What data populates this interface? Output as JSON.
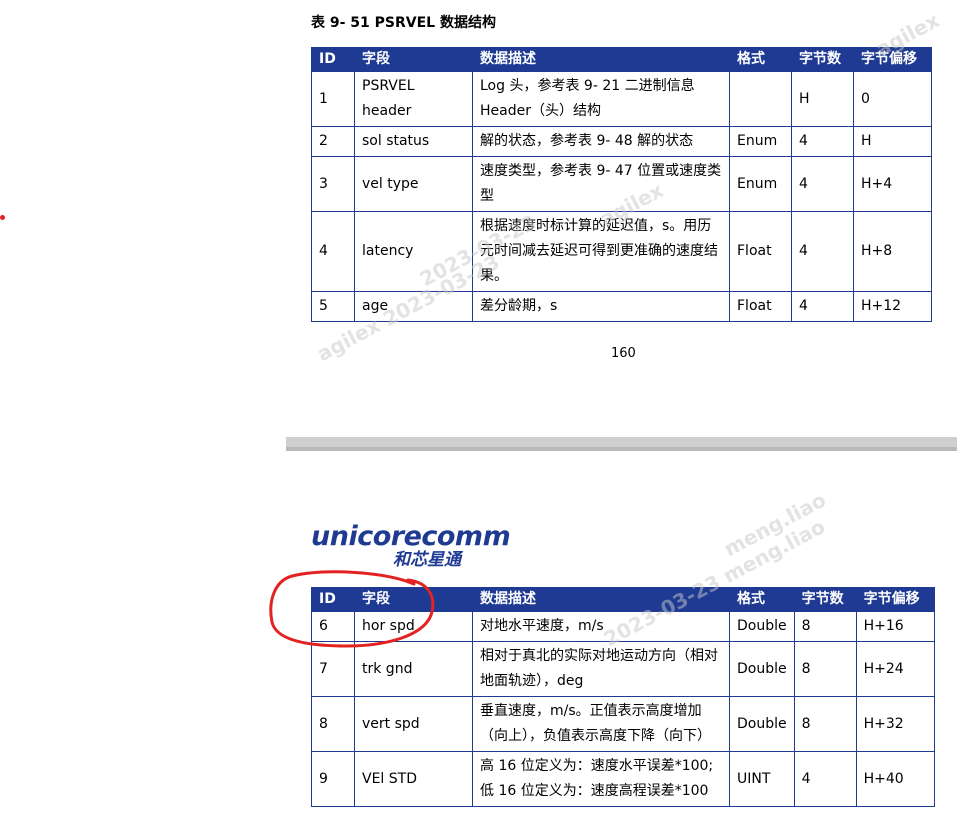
{
  "caption": "表 9- 51 PSRVEL 数据结构",
  "theme": {
    "header_bg": "#1f3a93",
    "annotation_color": "#e32222",
    "watermark_color": "rgba(200,200,200,0.5)"
  },
  "headers": [
    "ID",
    "字段",
    "数据描述",
    "格式",
    "字节数",
    "字节偏移"
  ],
  "table1_rows": [
    {
      "id": "1",
      "field": "PSRVEL header",
      "desc": "Log 头，参考表 9- 21 二进制信息 Header（头）结构",
      "format": "",
      "bytes": "H",
      "offset": "0"
    },
    {
      "id": "2",
      "field": "sol status",
      "desc": "解的状态，参考表 9- 48 解的状态",
      "format": "Enum",
      "bytes": "4",
      "offset": "H"
    },
    {
      "id": "3",
      "field": "vel type",
      "desc": "速度类型，参考表 9- 47 位置或速度类型",
      "format": "Enum",
      "bytes": "4",
      "offset": "H+4"
    },
    {
      "id": "4",
      "field": "latency",
      "desc": "根据速度时标计算的延迟值，s。用历元时间减去延迟可得到更准确的速度结果。",
      "format": "Float",
      "bytes": "4",
      "offset": "H+8"
    },
    {
      "id": "5",
      "field": "age",
      "desc": "差分龄期，s",
      "format": "Float",
      "bytes": "4",
      "offset": "H+12"
    }
  ],
  "page_number": "160",
  "logo": {
    "text_en": "unicorecomm",
    "text_cn": "和芯星通"
  },
  "table2_rows": [
    {
      "id": "6",
      "field": "hor spd",
      "desc": "对地水平速度，m/s",
      "format": "Double",
      "bytes": "8",
      "offset": "H+16"
    },
    {
      "id": "7",
      "field": "trk gnd",
      "desc": "相对于真北的实际对地运动方向（相对地面轨迹），deg",
      "format": "Double",
      "bytes": "8",
      "offset": "H+24"
    },
    {
      "id": "8",
      "field": "vert spd",
      "desc": "垂直速度，m/s。正值表示高度增加（向上），负值表示高度下降（向下）",
      "format": "Double",
      "bytes": "8",
      "offset": "H+32"
    },
    {
      "id": "9",
      "field": "VEl STD",
      "desc": "高 16 位定义为：速度水平误差*100; 低 16 位定义为：速度高程误差*100",
      "format": "UINT",
      "bytes": "4",
      "offset": "H+40"
    }
  ],
  "watermarks": [
    "agilex",
    "2023-03-23",
    "meng.liao",
    "agilex 2023-03-23",
    "agilex",
    "2023-03-23 meng.liao"
  ]
}
